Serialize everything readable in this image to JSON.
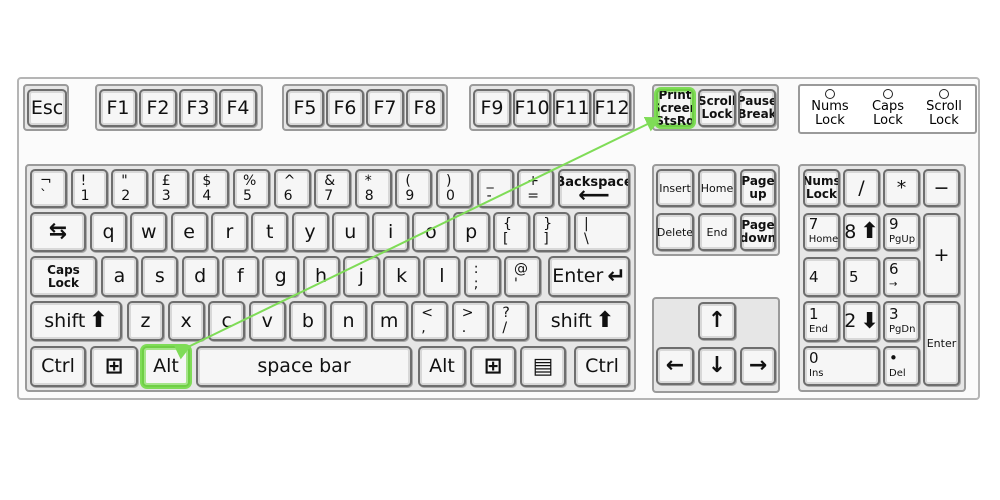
{
  "highlight_color": "#7fdc57",
  "lights": [
    "Nums Lock",
    "Caps Lock",
    "Scroll Lock"
  ],
  "keys": [
    {
      "label": "Esc"
    },
    {
      "label": "F1"
    },
    {
      "label": "F2"
    },
    {
      "label": "F3"
    },
    {
      "label": "F4"
    },
    {
      "label": "F5"
    },
    {
      "label": "F6"
    },
    {
      "label": "F7"
    },
    {
      "label": "F8"
    },
    {
      "label": "F9"
    },
    {
      "label": "F10"
    },
    {
      "label": "F11"
    },
    {
      "label": "F12"
    },
    {
      "stack": [
        "Print",
        "Screen",
        "StsRq"
      ],
      "highlighted": true
    },
    {
      "stack": [
        "Scroll",
        "Lock"
      ]
    },
    {
      "stack": [
        "Pause",
        "Break"
      ]
    },
    {
      "top": "¬",
      "bottom": "`"
    },
    {
      "top": "!",
      "bottom": "1"
    },
    {
      "top": "\"",
      "bottom": "2"
    },
    {
      "top": "£",
      "bottom": "3"
    },
    {
      "top": "$",
      "bottom": "4"
    },
    {
      "top": "%",
      "bottom": "5"
    },
    {
      "top": "^",
      "bottom": "6"
    },
    {
      "top": "&",
      "bottom": "7"
    },
    {
      "top": "*",
      "bottom": "8"
    },
    {
      "top": "(",
      "bottom": "9"
    },
    {
      "top": ")",
      "bottom": "0"
    },
    {
      "top": "_",
      "bottom": "-"
    },
    {
      "top": "+",
      "bottom": "="
    },
    {
      "label": "Backspace",
      "icon": "arrow-left",
      "vertical": true
    },
    {
      "icon": "tab-arrows"
    },
    {
      "label": "q"
    },
    {
      "label": "w"
    },
    {
      "label": "e"
    },
    {
      "label": "r"
    },
    {
      "label": "t"
    },
    {
      "label": "y"
    },
    {
      "label": "u"
    },
    {
      "label": "i"
    },
    {
      "label": "o"
    },
    {
      "label": "p"
    },
    {
      "top": "{",
      "bottom": "["
    },
    {
      "top": "}",
      "bottom": "]"
    },
    {
      "top": "|",
      "bottom": "\\"
    },
    {
      "stack": [
        "Caps",
        "Lock"
      ]
    },
    {
      "label": "a"
    },
    {
      "label": "s"
    },
    {
      "label": "d"
    },
    {
      "label": "f"
    },
    {
      "label": "g"
    },
    {
      "label": "h"
    },
    {
      "label": "j"
    },
    {
      "label": "k"
    },
    {
      "label": "l"
    },
    {
      "top": ":",
      "bottom": ";"
    },
    {
      "top": "@",
      "bottom": "'"
    },
    {
      "label": "Enter",
      "icon": "enter-arrow"
    },
    {
      "label": "shift",
      "icon": "arrow-up"
    },
    {
      "label": "z"
    },
    {
      "label": "x"
    },
    {
      "label": "c"
    },
    {
      "label": "v"
    },
    {
      "label": "b"
    },
    {
      "label": "n"
    },
    {
      "label": "m"
    },
    {
      "top": "<",
      "bottom": ","
    },
    {
      "top": ">",
      "bottom": "."
    },
    {
      "top": "?",
      "bottom": "/"
    },
    {
      "label": "shift",
      "icon": "arrow-up"
    },
    {
      "label": "Ctrl"
    },
    {
      "icon": "windows-logo"
    },
    {
      "label": "Alt",
      "highlighted": true
    },
    {
      "label": "space bar"
    },
    {
      "label": "Alt"
    },
    {
      "icon": "windows-logo"
    },
    {
      "icon": "menu"
    },
    {
      "label": "Ctrl"
    },
    {
      "label": "Insert",
      "small": true
    },
    {
      "label": "Home",
      "small": true
    },
    {
      "stack": [
        "Page",
        "up"
      ]
    },
    {
      "label": "Delete",
      "small": true
    },
    {
      "label": "End",
      "small": true
    },
    {
      "stack": [
        "Page",
        "down"
      ]
    },
    {
      "icon": "arrow-up-thin"
    },
    {
      "icon": "arrow-left-thin"
    },
    {
      "icon": "arrow-down-thin"
    },
    {
      "icon": "arrow-right-thin"
    },
    {
      "stack": [
        "Nums",
        "Lock"
      ]
    },
    {
      "label": "/"
    },
    {
      "label": "*"
    },
    {
      "label": "−"
    },
    {
      "num": "7",
      "sub": "Home"
    },
    {
      "label": "8",
      "icon": "arrow-up"
    },
    {
      "num": "9",
      "sub": "PgUp"
    },
    {
      "label": "+"
    },
    {
      "num": "4",
      "sub": ""
    },
    {
      "num": "5",
      "sub": ""
    },
    {
      "num": "6",
      "sub": "→"
    },
    {
      "num": "1",
      "sub": "End"
    },
    {
      "label": "2",
      "icon": "arrow-down"
    },
    {
      "num": "3",
      "sub": "PgDn"
    },
    {
      "label": "Enter",
      "small": true
    },
    {
      "num": "0",
      "sub": "Ins"
    },
    {
      "num": "•",
      "sub": "Del"
    }
  ]
}
